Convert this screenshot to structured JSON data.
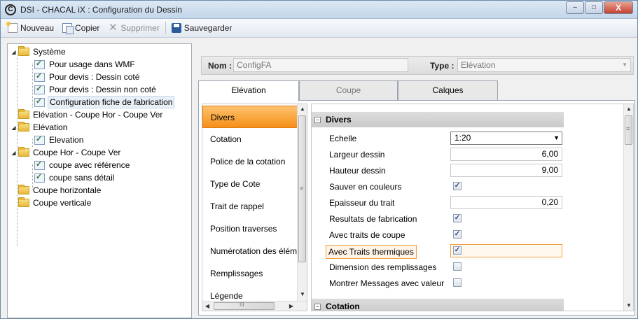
{
  "window": {
    "title": "DSI - CHACAL iX : Configuration du Dessin",
    "app_icon_glyph": "C",
    "buttons": {
      "minimize": "–",
      "maximize": "□",
      "close": "X"
    }
  },
  "toolbar": {
    "new_label": "Nouveau",
    "copy_label": "Copier",
    "delete_label": "Supprimer",
    "save_label": "Sauvegarder"
  },
  "tree": {
    "nodes": [
      {
        "label": "Système",
        "type": "folder",
        "expanded": true
      },
      {
        "label": "Pour usage dans WMF",
        "type": "doc"
      },
      {
        "label": "Pour devis : Dessin coté",
        "type": "doc"
      },
      {
        "label": "Pour devis : Dessin non coté",
        "type": "doc"
      },
      {
        "label": "Configuration fiche de fabrication",
        "type": "doc",
        "selected": true
      },
      {
        "label": "Elévation - Coupe Hor - Coupe Ver",
        "type": "folder"
      },
      {
        "label": "Elévation",
        "type": "folder",
        "expanded": true
      },
      {
        "label": "Elevation",
        "type": "doc"
      },
      {
        "label": "Coupe Hor - Coupe Ver",
        "type": "folder",
        "expanded": true
      },
      {
        "label": "coupe avec référence",
        "type": "doc"
      },
      {
        "label": "coupe sans détail",
        "type": "doc"
      },
      {
        "label": "Coupe horizontale",
        "type": "folder"
      },
      {
        "label": "Coupe verticale",
        "type": "folder"
      }
    ]
  },
  "header": {
    "nom_label": "Nom :",
    "nom_value": "ConfigFA",
    "type_label": "Type :",
    "type_value": "Elévation"
  },
  "tabs": [
    {
      "label": "Elévation",
      "active": true
    },
    {
      "label": "Coupe",
      "active": false
    },
    {
      "label": "Calques",
      "active": false
    }
  ],
  "categories": [
    {
      "label": "Divers",
      "active": true
    },
    {
      "label": "Cotation"
    },
    {
      "label": "Police de la cotation"
    },
    {
      "label": "Type de Cote"
    },
    {
      "label": "Trait de rappel"
    },
    {
      "label": "Position traverses"
    },
    {
      "label": "Numérotation des élém"
    },
    {
      "label": "Remplissages"
    },
    {
      "label": "Légende"
    }
  ],
  "scroll": {
    "hthumb_glyph": "III",
    "vthumb_glyph": "≡"
  },
  "properties": {
    "section_divers": "Divers",
    "section_cotation": "Cotation",
    "collapse_glyph": "−",
    "rows": [
      {
        "label": "Echelle",
        "kind": "select",
        "value": "1:20"
      },
      {
        "label": "Largeur dessin",
        "kind": "number",
        "value": "6,00"
      },
      {
        "label": "Hauteur dessin",
        "kind": "number",
        "value": "9,00"
      },
      {
        "label": "Sauver en couleurs",
        "kind": "check",
        "checked": true
      },
      {
        "label": "Epaisseur du trait",
        "kind": "number",
        "value": "0,20"
      },
      {
        "label": "Resultats de fabrication",
        "kind": "check",
        "checked": true
      },
      {
        "label": "Avec traits de coupe",
        "kind": "check",
        "checked": true
      },
      {
        "label": "Avec Traits thermiques",
        "kind": "check",
        "checked": true,
        "highlighted": true
      },
      {
        "label": "Dimension des remplissages",
        "kind": "check",
        "checked": false
      },
      {
        "label": "Montrer Messages avec valeur",
        "kind": "check",
        "checked": false
      }
    ]
  },
  "colors": {
    "active_category": "#f59a2a",
    "highlight_border": "#f0a040",
    "title_bar": "#c4d6ea"
  }
}
